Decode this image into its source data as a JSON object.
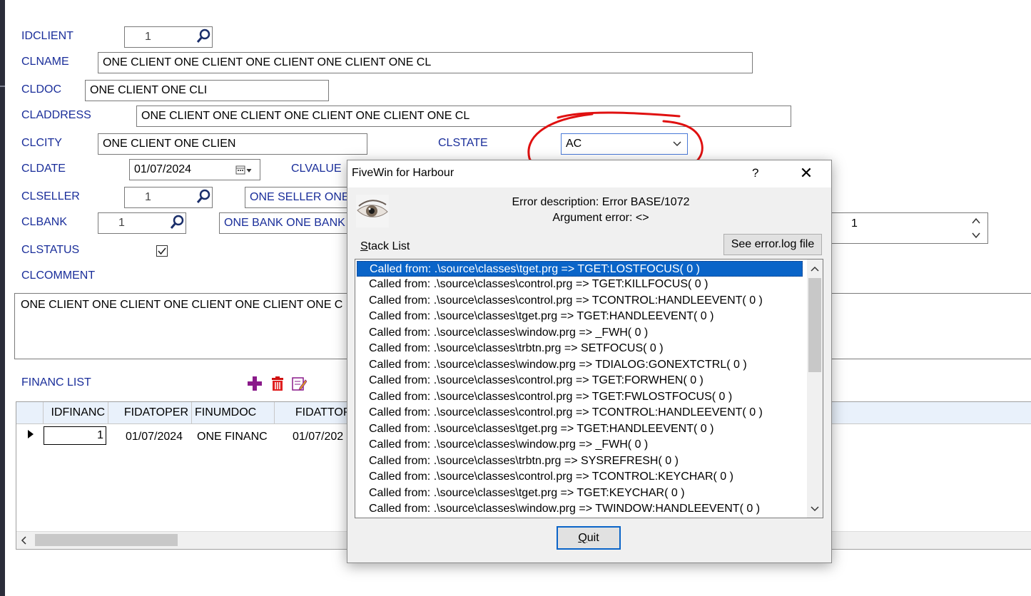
{
  "form": {
    "idclient": {
      "label": "IDCLIENT",
      "value": "1"
    },
    "clname": {
      "label": "CLNAME",
      "value": "ONE CLIENT ONE CLIENT ONE CLIENT ONE CLIENT ONE CL"
    },
    "cldoc": {
      "label": "CLDOC",
      "value": "ONE CLIENT ONE CLI"
    },
    "claddress": {
      "label": "CLADDRESS",
      "value": "ONE CLIENT ONE CLIENT ONE CLIENT ONE CLIENT ONE CL"
    },
    "clcity": {
      "label": "CLCITY",
      "value": "ONE CLIENT ONE CLIEN"
    },
    "clstate": {
      "label": "CLSTATE",
      "value": "AC"
    },
    "cldate": {
      "label": "CLDATE",
      "value": "01/07/2024"
    },
    "clvalue": {
      "label": "CLVALUE"
    },
    "clseller": {
      "label": "CLSELLER",
      "value": "1",
      "name": "ONE SELLER ONE"
    },
    "clbank": {
      "label": "CLBANK",
      "value": "1",
      "name": "ONE BANK ONE BANK",
      "spin_value": "1"
    },
    "clstatus": {
      "label": "CLSTATUS",
      "checked": true
    },
    "clcomment": {
      "label": "CLCOMMENT",
      "value": "ONE CLIENT ONE CLIENT ONE CLIENT ONE CLIENT ONE C"
    }
  },
  "financ": {
    "label": "FINANC LIST",
    "columns": [
      "IDFINANC",
      "FIDATOPER",
      "FINUMDOC",
      "FIDATTOPA"
    ],
    "rows": [
      {
        "idfinanc": "1",
        "fidatoper": "01/07/2024",
        "finumdoc": "ONE FINANC",
        "fidattopa": "01/07/202"
      }
    ]
  },
  "dialog": {
    "title": "FiveWin for Harbour",
    "help": "?",
    "close": "✕",
    "error_description": "Error description: Error BASE/1072",
    "argument_error": "Argument error: <>",
    "see_log_button": "See error.log file",
    "stack_label_first": "S",
    "stack_label_rest": "tack List",
    "quit_first": "Q",
    "quit_rest": "uit",
    "stack": [
      "Called from: .\\source\\classes\\tget.prg => TGET:LOSTFOCUS( 0 )",
      "Called from: .\\source\\classes\\control.prg => TGET:KILLFOCUS( 0 )",
      "Called from: .\\source\\classes\\control.prg => TCONTROL:HANDLEEVENT( 0 )",
      "Called from: .\\source\\classes\\tget.prg => TGET:HANDLEEVENT( 0 )",
      "Called from: .\\source\\classes\\window.prg => _FWH( 0 )",
      "Called from: .\\source\\classes\\trbtn.prg => SETFOCUS( 0 )",
      "Called from: .\\source\\classes\\window.prg => TDIALOG:GONEXTCTRL( 0 )",
      "Called from: .\\source\\classes\\control.prg => TGET:FORWHEN( 0 )",
      "Called from: .\\source\\classes\\control.prg => TGET:FWLOSTFOCUS( 0 )",
      "Called from: .\\source\\classes\\control.prg => TCONTROL:HANDLEEVENT( 0 )",
      "Called from: .\\source\\classes\\tget.prg => TGET:HANDLEEVENT( 0 )",
      "Called from: .\\source\\classes\\window.prg => _FWH( 0 )",
      "Called from: .\\source\\classes\\trbtn.prg => SYSREFRESH( 0 )",
      "Called from: .\\source\\classes\\control.prg => TCONTROL:KEYCHAR( 0 )",
      "Called from: .\\source\\classes\\tget.prg => TGET:KEYCHAR( 0 )",
      "Called from: .\\source\\classes\\window.prg => TWINDOW:HANDLEEVENT( 0 )"
    ]
  },
  "colors": {
    "label_blue": "#1a2e9a",
    "selection": "#0a64c8",
    "annotation_red": "#e01010"
  }
}
